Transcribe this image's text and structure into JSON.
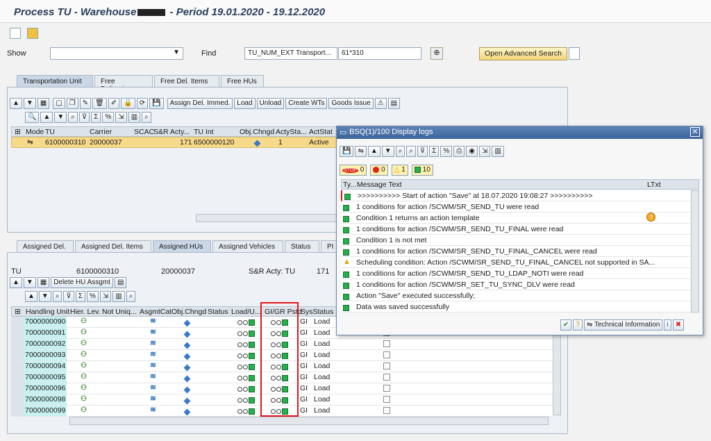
{
  "title": "Process TU - Warehouse",
  "title_tail": " - Period 19.01.2020 - 19.12.2020",
  "show_label": "Show",
  "find_label": "Find",
  "find_select": "TU_NUM_EXT Transport...",
  "find_value": "61*310",
  "open_adv_search": "Open Advanced Search",
  "tabs_top": [
    "Transportation Unit",
    "Free Deliveries",
    "Free Del. Items",
    "Free HUs"
  ],
  "toolbar_top": {
    "assign_del": "Assign Del. Immed.",
    "load": "Load",
    "unload": "Unload",
    "create_wts": "Create WTs",
    "goods_issue": "Goods Issue"
  },
  "tu_grid": {
    "headers": [
      "Mode",
      "TU",
      "Carrier",
      "SCAC",
      "S&R Acty...",
      "TU Int",
      "Obj.Chngd",
      "ActySta...",
      "ActStat"
    ],
    "row": {
      "tu": "6100000310",
      "carrier": "20000037",
      "sr": "171",
      "tuint": "6500000120",
      "actysta": "1",
      "actstat": "Active"
    }
  },
  "tabs_bottom": [
    "Assigned Del.",
    "Assigned Del. Items",
    "Assigned HUs",
    "Assigned Vehicles",
    "Status",
    "PI"
  ],
  "tu_info": {
    "label": "TU",
    "tu": "6100000310",
    "carrier": "20000037",
    "sr_label": "S&R Acty: TU",
    "sr_value": "171"
  },
  "delete_hu": "Delete HU Assgmt",
  "hu_headers": [
    "Handling Unit",
    "Hier. Lev.",
    "Not Uniq...",
    "AsgmtCat",
    "Obj.Chngd",
    "Status",
    "Load/U...",
    "GI/GR Pstd",
    "SysStatus"
  ],
  "hu_rows": [
    {
      "hu": "7000000090",
      "gi": "GI",
      "sys": "Load"
    },
    {
      "hu": "7000000091",
      "gi": "GI",
      "sys": "Load"
    },
    {
      "hu": "7000000092",
      "gi": "GI",
      "sys": "Load"
    },
    {
      "hu": "7000000093",
      "gi": "GI",
      "sys": "Load"
    },
    {
      "hu": "7000000094",
      "gi": "GI",
      "sys": "Load"
    },
    {
      "hu": "7000000095",
      "gi": "GI",
      "sys": "Load"
    },
    {
      "hu": "7000000096",
      "gi": "GI",
      "sys": "Load"
    },
    {
      "hu": "7000000098",
      "gi": "GI",
      "sys": "Load"
    },
    {
      "hu": "7000000099",
      "gi": "GI",
      "sys": "Load"
    }
  ],
  "dialog": {
    "title": "BSQ(1)/100 Display logs",
    "counts": {
      "stop": "0",
      "error": "0",
      "warn": "1",
      "ok": "10"
    },
    "col_ty": "Ty...",
    "col_msg": "Message Text",
    "col_ltxt": "LTxt",
    "messages": [
      {
        "type": "ok",
        "text": ">>>>>>>>>> Start of action \"Save\" at 18.07.2020 19:08:27 >>>>>>>>>>"
      },
      {
        "type": "ok",
        "text": "1 conditions for action /SCWM/SR_SEND_TU were read"
      },
      {
        "type": "ok",
        "text": "Condition 1 returns an action template"
      },
      {
        "type": "ok",
        "text": "1 conditions for action /SCWM/SR_SEND_TU_FINAL were read"
      },
      {
        "type": "ok",
        "text": "Condition 1 is not met"
      },
      {
        "type": "ok",
        "text": "1 conditions for action /SCWM/SR_SEND_TU_FINAL_CANCEL were read"
      },
      {
        "type": "warn",
        "text": "Scheduling condition: Action /SCWM/SR_SEND_TU_FINAL_CANCEL not supported in SA..."
      },
      {
        "type": "ok",
        "text": "1 conditions for action /SCWM/SR_SEND_TU_LDAP_NOTI were read"
      },
      {
        "type": "ok",
        "text": "1 conditions for action /SCWM/SR_SET_TU_SYNC_DLV were read"
      },
      {
        "type": "ok",
        "text": "Action \"Save\" executed successfully;"
      },
      {
        "type": "ok",
        "text": "Data was saved successfully"
      }
    ],
    "tech_info": "Technical Information"
  }
}
